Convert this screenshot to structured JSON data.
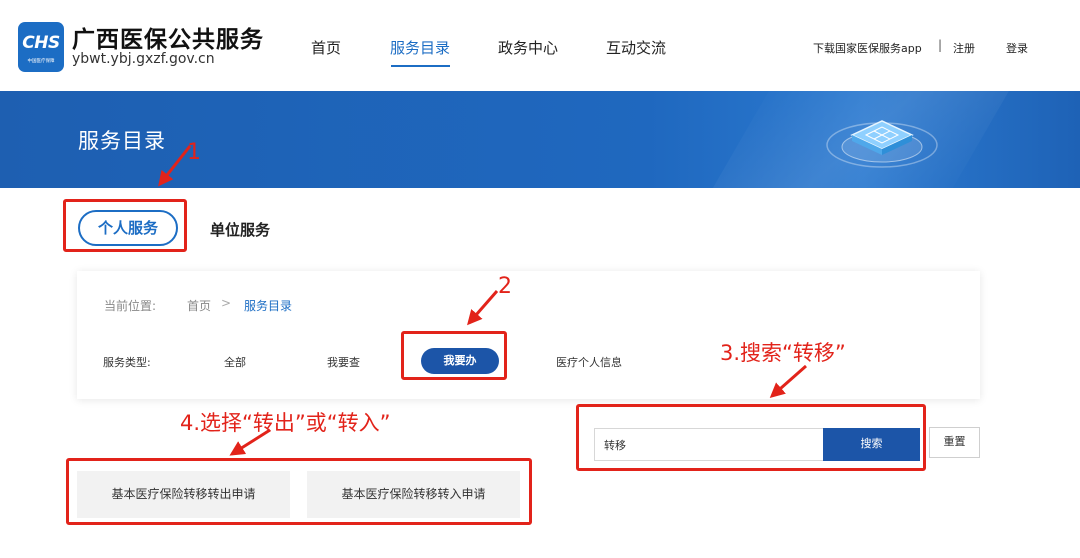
{
  "header": {
    "logo_text": "CHS",
    "logo_subtext": "中国医疗保障",
    "site_name": "广西医保公共服务",
    "site_url": "ybwt.ybj.gxzf.gov.cn",
    "nav": [
      {
        "label": "首页",
        "active": false
      },
      {
        "label": "服务目录",
        "active": true
      },
      {
        "label": "政务中心",
        "active": false
      },
      {
        "label": "互动交流",
        "active": false
      }
    ],
    "download_link": "下载国家医保服务app",
    "separator": "|",
    "register": "注册",
    "login": "登录"
  },
  "banner": {
    "title": "服务目录"
  },
  "tabs": {
    "personal": "个人服务",
    "unit": "单位服务"
  },
  "breadcrumb": {
    "label": "当前位置:",
    "home": "首页",
    "arrow": ">",
    "current": "服务目录"
  },
  "service_type": {
    "label": "服务类型:",
    "options": [
      "全部",
      "我要查",
      "我要办",
      "医疗个人信息"
    ],
    "selected": "我要办"
  },
  "search": {
    "value": "转移",
    "button": "搜索",
    "reset": "重置"
  },
  "results": [
    "基本医疗保险转移转出申请",
    "基本医疗保险转移转入申请"
  ],
  "annotations": {
    "n1": "1",
    "n2": "2",
    "step3": "3.搜索“转移”",
    "step4": "4.选择“转出”或“转入”"
  },
  "colors": {
    "brand_blue": "#1c6dc4",
    "button_blue": "#1c55a8",
    "annotation_red": "#e2231a"
  }
}
